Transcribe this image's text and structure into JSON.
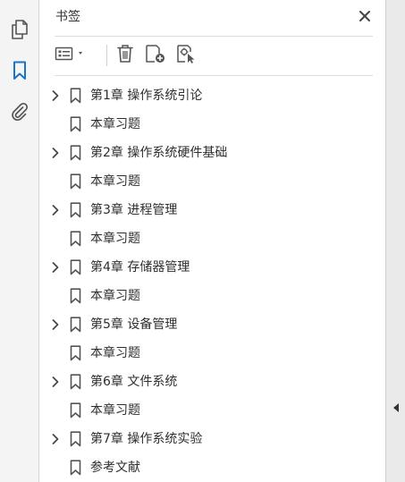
{
  "panel": {
    "title": "书签"
  },
  "bookmarks": [
    {
      "label": "第1章 操作系统引论",
      "expandable": true
    },
    {
      "label": "本章习题",
      "expandable": false
    },
    {
      "label": "第2章 操作系统硬件基础",
      "expandable": true
    },
    {
      "label": "本章习题",
      "expandable": false
    },
    {
      "label": "第3章 进程管理",
      "expandable": true
    },
    {
      "label": "本章习题",
      "expandable": false
    },
    {
      "label": "第4章 存储器管理",
      "expandable": true
    },
    {
      "label": "本章习题",
      "expandable": false
    },
    {
      "label": "第5章 设备管理",
      "expandable": true
    },
    {
      "label": "本章习题",
      "expandable": false
    },
    {
      "label": "第6章 文件系统",
      "expandable": true
    },
    {
      "label": "本章习题",
      "expandable": false
    },
    {
      "label": "第7章 操作系统实验",
      "expandable": true
    },
    {
      "label": "参考文献",
      "expandable": false
    }
  ],
  "icons": {
    "rail": [
      "pages-icon",
      "bookmarks-icon",
      "attachments-icon"
    ],
    "toolbar": [
      "options-menu-icon",
      "delete-icon",
      "new-bookmark-icon",
      "bookmark-properties-icon"
    ]
  },
  "colors": {
    "accent": "#1a73c8",
    "icon": "#555555"
  }
}
